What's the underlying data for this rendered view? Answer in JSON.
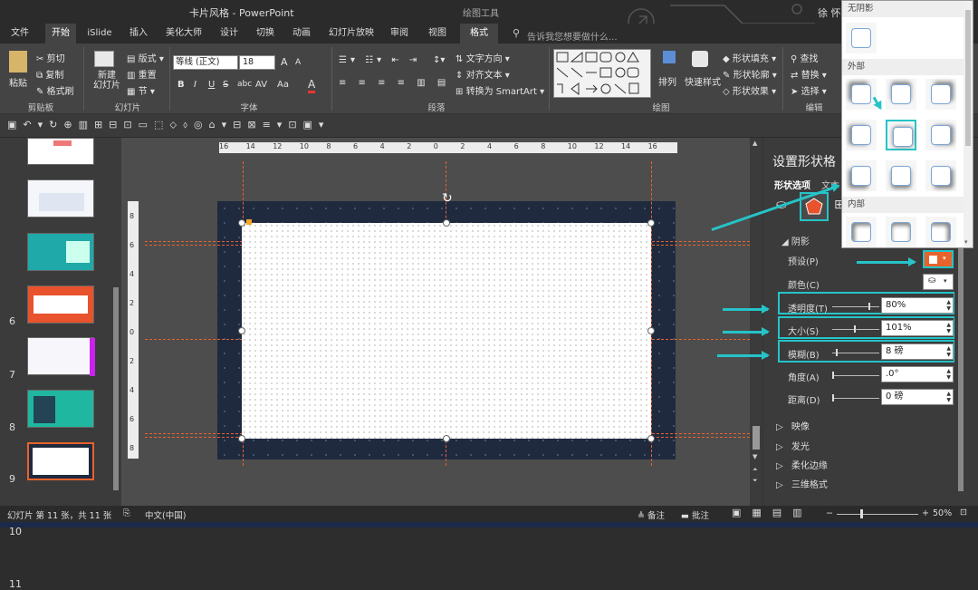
{
  "window": {
    "title": "卡片风格 - PowerPoint",
    "context_tab": "绘图工具",
    "user": "徐 怀"
  },
  "tabs": [
    "文件",
    "开始",
    "iSlide",
    "插入",
    "美化大师",
    "设计",
    "切换",
    "动画",
    "幻灯片放映",
    "审阅",
    "视图",
    "格式"
  ],
  "search_placeholder": "告诉我您想要做什么...",
  "ribbon": {
    "clipboard": {
      "paste": "粘贴",
      "cut": "剪切",
      "copy": "复制",
      "format_painter": "格式刷",
      "label": "剪贴板"
    },
    "slides": {
      "new_slide": "新建\n幻灯片",
      "layout": "版式",
      "reset": "重置",
      "section": "节",
      "label": "幻灯片"
    },
    "font": {
      "name": "等线 (正文)",
      "size": "18",
      "bold": "B",
      "italic": "I",
      "underline": "U",
      "strike": "S",
      "shadow": "abc",
      "spacing": "AV",
      "case": "Aa",
      "color": "A",
      "grow": "A",
      "shrink": "A",
      "label": "字体"
    },
    "paragraph": {
      "text_direction": "文字方向",
      "align_text": "对齐文本",
      "smartart": "转换为 SmartArt",
      "label": "段落"
    },
    "drawing": {
      "arrange": "排列",
      "quick_styles": "快速样式",
      "fill": "形状填充",
      "outline": "形状轮廓",
      "effects": "形状效果",
      "label": "绘图"
    },
    "editing": {
      "find": "查找",
      "replace": "替换",
      "select": "选择",
      "label": "编辑"
    }
  },
  "thumbnails": [
    {
      "num": "",
      "bg": "#ffffff"
    },
    {
      "num": "6",
      "bg": "#f4f6fa"
    },
    {
      "num": "7",
      "bg": "#1fa9a8"
    },
    {
      "num": "8",
      "bg": "#e8522c"
    },
    {
      "num": "9",
      "bg": "#f7f7fb"
    },
    {
      "num": "10",
      "bg": "#1fb7a0"
    },
    {
      "num": "11",
      "bg": "#1f2a3f"
    }
  ],
  "ruler_h": [
    "16",
    "14",
    "12",
    "10",
    "8",
    "6",
    "4",
    "2",
    "0",
    "2",
    "4",
    "6",
    "8",
    "10",
    "12",
    "14",
    "16"
  ],
  "ruler_v": [
    "8",
    "6",
    "4",
    "2",
    "0",
    "2",
    "4",
    "6",
    "8"
  ],
  "pane": {
    "title": "设置形状格",
    "tab_shape": "形状选项",
    "tab_text": "文本",
    "section_shadow": "阴影",
    "preset": "预设(P)",
    "color": "颜色(C)",
    "transparency": {
      "label": "透明度(T)",
      "value": "80%"
    },
    "size": {
      "label": "大小(S)",
      "value": "101%"
    },
    "blur": {
      "label": "模糊(B)",
      "value": "8 磅"
    },
    "angle": {
      "label": "角度(A)",
      "value": ".0°"
    },
    "distance": {
      "label": "距离(D)",
      "value": "0 磅"
    },
    "reflection": "映像",
    "glow": "发光",
    "soft_edges": "柔化边缘",
    "threed": "三维格式"
  },
  "popup": {
    "none": "无阴影",
    "outer": "外部",
    "inner": "内部"
  },
  "status": {
    "slide": "幻灯片 第 11 张，共 11 张",
    "lang": "中文(中国)",
    "notes": "备注",
    "comments": "批注",
    "zoom": "50%"
  },
  "colors": {
    "accent": "#25c4c8",
    "preset_box": "#e8622c",
    "slide_bg": "#1f2a3f"
  }
}
